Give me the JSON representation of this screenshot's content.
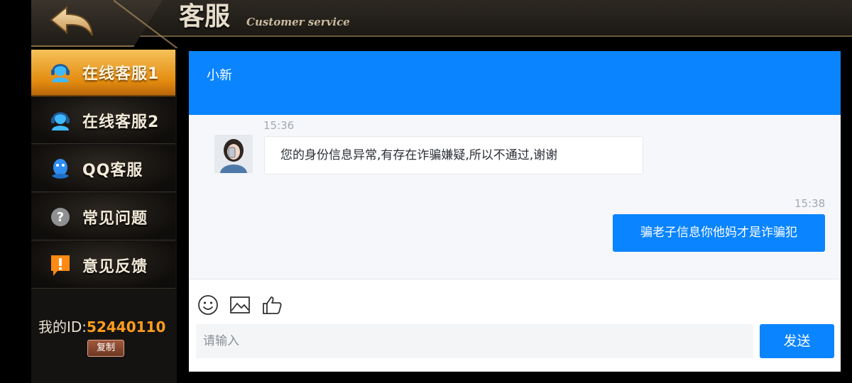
{
  "header": {
    "title": "客服",
    "subtitle": "Customer service",
    "back_icon": "back-arrow-icon"
  },
  "sidebar": {
    "items": [
      {
        "label": "在线客服1",
        "icon": "agent-headset-icon",
        "active": true
      },
      {
        "label": "在线客服2",
        "icon": "agent-headset-icon",
        "active": false
      },
      {
        "label": "QQ客服",
        "icon": "qq-penguin-icon",
        "active": false
      },
      {
        "label": "常见问题",
        "icon": "question-icon",
        "active": false
      },
      {
        "label": "意见反馈",
        "icon": "exclamation-icon",
        "active": false
      }
    ],
    "id_label": "我的ID:",
    "id_value": "52440110",
    "copy_label": "复制"
  },
  "chat": {
    "agent_name": "小新",
    "messages": [
      {
        "from": "agent",
        "time": "15:36",
        "text": "您的身份信息异常,有存在诈骗嫌疑,所以不通过,谢谢"
      },
      {
        "from": "user",
        "time": "15:38",
        "text": "骗老子信息你他妈才是诈骗犯"
      }
    ],
    "toolbar": [
      "smiley-icon",
      "image-icon",
      "thumbs-up-icon"
    ],
    "input_placeholder": "请输入",
    "send_label": "发送"
  },
  "colors": {
    "accent": "#0a84ff",
    "sidebar_active": "#e38b0f",
    "id_value": "#ff9d1c"
  }
}
